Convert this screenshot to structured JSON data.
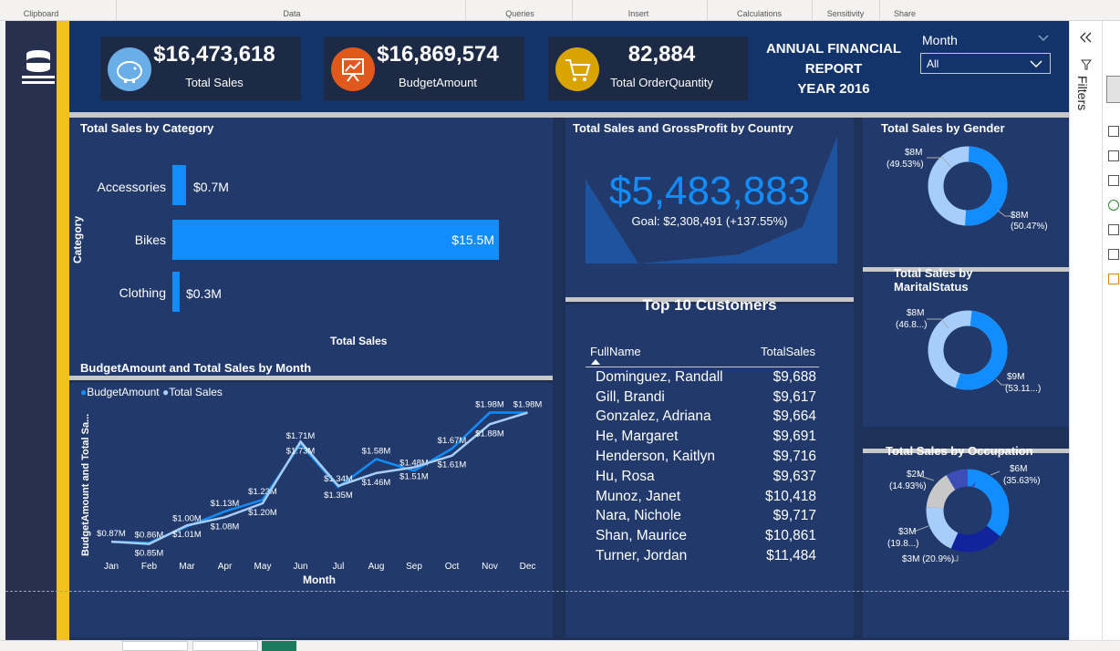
{
  "ribbon": {
    "groups": [
      "Clipboard",
      "Data",
      "Queries",
      "Insert",
      "Calculations",
      "Sensitivity",
      "Share"
    ]
  },
  "kpis": {
    "total_sales": {
      "value": "$16,473,618",
      "label": "Total Sales"
    },
    "budget": {
      "value": "$16,869,574",
      "label": "BudgetAmount"
    },
    "quantity": {
      "value": "82,884",
      "label": "Total OrderQuantity"
    }
  },
  "report_title": {
    "line1": "ANNUAL FINANCIAL",
    "line2": "REPORT",
    "line3": "YEAR 2016"
  },
  "slicer": {
    "title": "Month",
    "value": "All"
  },
  "category_panel": {
    "title": "Total Sales by Category",
    "ylabel": "Category",
    "xlabel": "Total Sales",
    "items": [
      {
        "name": "Accessories",
        "label": "$0.7M"
      },
      {
        "name": "Bikes",
        "label": "$15.5M"
      },
      {
        "name": "Clothing",
        "label": "$0.3M"
      }
    ]
  },
  "country_panel": {
    "title": "Total Sales and GrossProfit by Country",
    "value": "$5,483,883",
    "goal": "Goal: $2,308,491 (+137.55%)"
  },
  "customers": {
    "title": "Top 10 Customers",
    "col_name": "FullName",
    "col_sales": "TotalSales",
    "rows": [
      {
        "name": "Dominguez, Randall",
        "sales": "$9,688"
      },
      {
        "name": "Gill, Brandi",
        "sales": "$9,617"
      },
      {
        "name": "Gonzalez, Adriana",
        "sales": "$9,664"
      },
      {
        "name": "He, Margaret",
        "sales": "$9,691"
      },
      {
        "name": "Henderson, Kaitlyn",
        "sales": "$9,716"
      },
      {
        "name": "Hu, Rosa",
        "sales": "$9,637"
      },
      {
        "name": "Munoz, Janet",
        "sales": "$10,418"
      },
      {
        "name": "Nara, Nichole",
        "sales": "$9,717"
      },
      {
        "name": "Shan, Maurice",
        "sales": "$10,861"
      },
      {
        "name": "Turner, Jordan",
        "sales": "$11,484"
      }
    ]
  },
  "gender": {
    "title": "Total Sales by Gender",
    "label_a": "$8M",
    "pct_a": "(49.53%)",
    "label_b": "$8M",
    "pct_b": "(50.47%)"
  },
  "marital": {
    "title1": "Total Sales by",
    "title2": "MaritalStatus",
    "label_a": "$8M",
    "pct_a": "(46.8...)",
    "label_b": "$9M",
    "pct_b": "(53.11...)"
  },
  "occupation": {
    "title": "Total Sales by Occupation",
    "l1": "$6M",
    "p1": "(35.63%)",
    "l2": "$2M",
    "p2": "(14.93%)",
    "l3": "$3M",
    "p3": "(19.8...)",
    "l4": "$3M (20.9%)"
  },
  "right_pane": {
    "filters_label": "Filters"
  },
  "chart_data": [
    {
      "type": "bar",
      "title": "Total Sales by Category",
      "categories": [
        "Accessories",
        "Bikes",
        "Clothing"
      ],
      "values": [
        0.7,
        15.5,
        0.3
      ],
      "xlabel": "Total Sales",
      "ylabel": "Category"
    },
    {
      "type": "pie",
      "title": "Total Sales by Gender",
      "values": [
        49.53,
        50.47
      ],
      "colors": [
        "#a6cdfb",
        "#118dff"
      ]
    },
    {
      "type": "pie",
      "title": "Total Sales by MaritalStatus",
      "values": [
        46.89,
        53.11
      ],
      "colors": [
        "#a6cdfb",
        "#118dff"
      ]
    },
    {
      "type": "pie",
      "title": "Total Sales by Occupation",
      "values": [
        35.63,
        20.9,
        19.8,
        14.93,
        8.74
      ],
      "colors": [
        "#118dff",
        "#12239e",
        "#a6cdfb",
        "#c8c8c8",
        "#3d4db8"
      ]
    },
    {
      "type": "line",
      "title": "BudgetAmount and Total Sales by Month",
      "xlabel": "Month",
      "ylabel": "BudgetAmount and Total Sa...",
      "categories": [
        "Jan",
        "Feb",
        "Mar",
        "Apr",
        "May",
        "Jun",
        "Jul",
        "Aug",
        "Sep",
        "Oct",
        "Nov",
        "Dec"
      ],
      "series": [
        {
          "name": "BudgetAmount",
          "values": [
            0.87,
            0.86,
            1.0,
            1.13,
            1.23,
            1.71,
            1.34,
            1.58,
            1.48,
            1.67,
            1.98,
            1.98
          ],
          "labels": [
            "$0.87M",
            "$0.86M",
            "$1.00M",
            "$1.13M",
            "$1.23M",
            "$1.71M",
            "$1.34M",
            "$1.58M",
            "$1.48M",
            "$1.67M",
            "$1.98M",
            "$1.98M"
          ]
        },
        {
          "name": "Total Sales",
          "values": [
            0.87,
            0.85,
            1.01,
            1.08,
            1.2,
            1.73,
            1.35,
            1.46,
            1.51,
            1.61,
            1.88,
            1.98
          ],
          "labels": [
            "",
            "$0.85M",
            "$1.01M",
            "$1.08M",
            "$1.20M",
            "$1.73M",
            "$1.35M",
            "$1.46M",
            "$1.51M",
            "$1.61M",
            "$1.88M",
            ""
          ]
        }
      ],
      "colors": {
        "BudgetAmount": "#118dff",
        "Total Sales": "#a6cdfb"
      }
    }
  ]
}
